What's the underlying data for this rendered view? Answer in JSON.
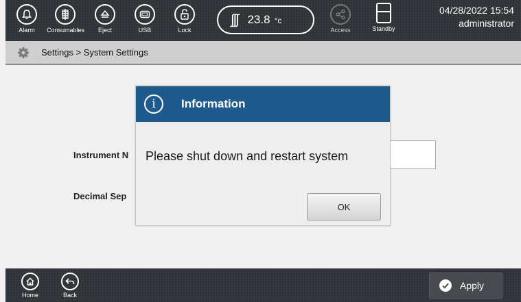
{
  "topbar": {
    "buttons": [
      {
        "label": "Alarm",
        "icon": "bell-icon"
      },
      {
        "label": "Consumables",
        "icon": "consumables-icon"
      },
      {
        "label": "Eject",
        "icon": "eject-icon"
      },
      {
        "label": "USB",
        "icon": "usb-icon"
      },
      {
        "label": "Lock",
        "icon": "unlock-icon"
      }
    ],
    "temperature": {
      "value": "23.8",
      "unit": "°c",
      "icon": "heat-icon",
      "heat_glyph": "∫∫∫"
    },
    "access": {
      "label": "Access",
      "icon": "share-icon"
    },
    "standby": {
      "label": "Standby",
      "icon": "standby-icon"
    },
    "datetime": "04/28/2022 15:54",
    "user": "administrator"
  },
  "breadcrumb": {
    "icon": "gear-icon",
    "text": "Settings > System Settings"
  },
  "form": {
    "instrument_label": "Instrument N",
    "decimal_label": "Decimal Sep"
  },
  "dialog": {
    "icon": "info-icon",
    "icon_glyph": "i",
    "title": "Information",
    "message": "Please shut down and restart system",
    "ok_label": "OK"
  },
  "bottombar": {
    "home": {
      "label": "Home",
      "icon": "home-icon"
    },
    "back": {
      "label": "Back",
      "icon": "back-arrow-icon"
    },
    "apply": {
      "label": "Apply",
      "icon": "check-icon"
    }
  },
  "colors": {
    "header_dark": "#2f3438",
    "dialog_header": "#1f5a8c",
    "crumb_bg": "#cfcfcf"
  }
}
